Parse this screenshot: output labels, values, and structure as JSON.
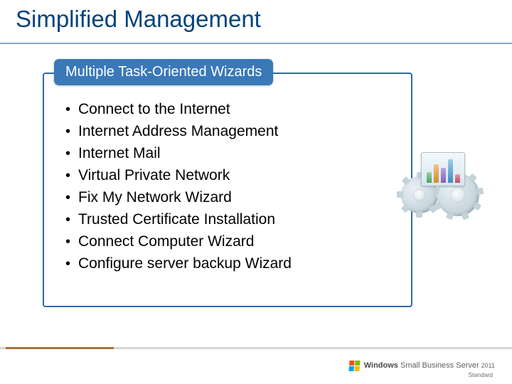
{
  "title": "Simplified Management",
  "panel": {
    "header": "Multiple Task-Oriented Wizards",
    "bullets": [
      "Connect to the Internet",
      "Internet Address Management",
      "Internet Mail",
      "Virtual Private Network",
      "Fix My Network Wizard",
      "Trusted Certificate Installation",
      "Connect Computer Wizard",
      "Configure server backup Wizard"
    ]
  },
  "brand": {
    "name_prefix": "Windows",
    "name_suffix": "Small Business Server",
    "year": "2011",
    "sub": "Standard"
  }
}
